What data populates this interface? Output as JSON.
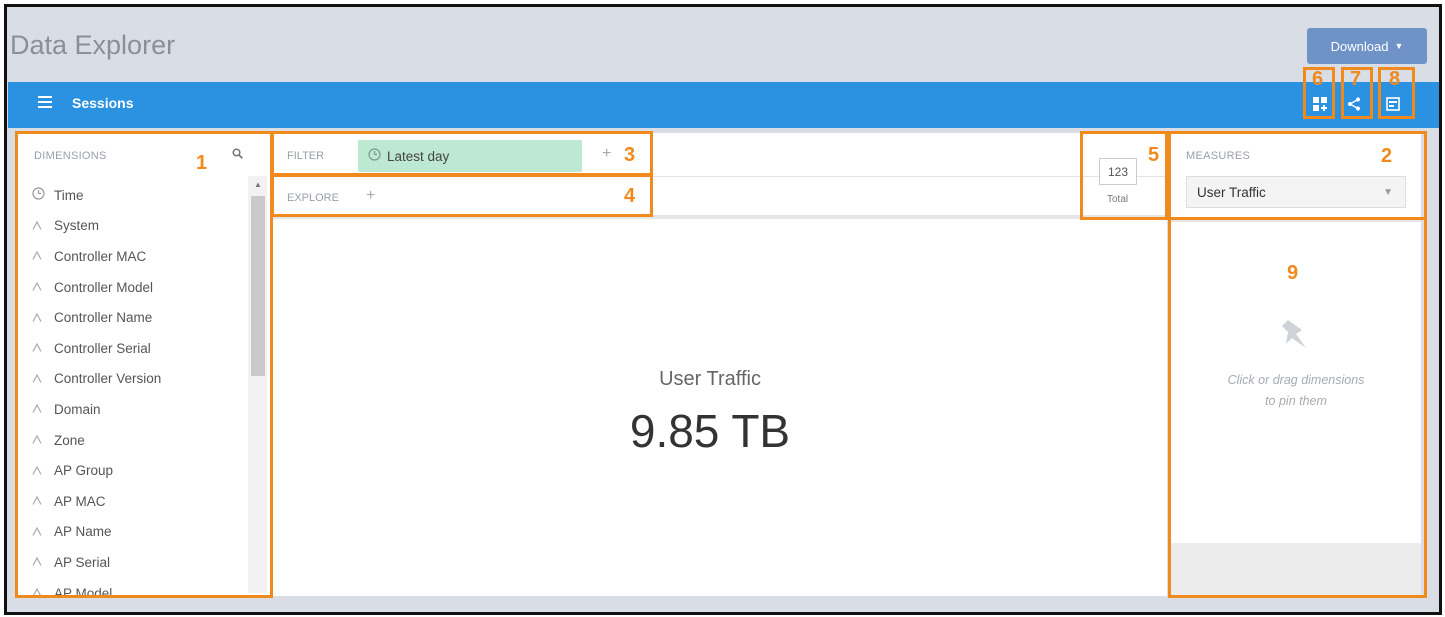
{
  "app": {
    "title": "Data Explorer",
    "download_label": "Download"
  },
  "topbar": {
    "title": "Sessions"
  },
  "dimensions": {
    "header": "DIMENSIONS",
    "items": [
      {
        "label": "Time",
        "icon": "clock-icon"
      },
      {
        "label": "System",
        "icon": "string-icon"
      },
      {
        "label": "Controller MAC",
        "icon": "string-icon"
      },
      {
        "label": "Controller Model",
        "icon": "string-icon"
      },
      {
        "label": "Controller Name",
        "icon": "string-icon"
      },
      {
        "label": "Controller Serial",
        "icon": "string-icon"
      },
      {
        "label": "Controller Version",
        "icon": "string-icon"
      },
      {
        "label": "Domain",
        "icon": "string-icon"
      },
      {
        "label": "Zone",
        "icon": "string-icon"
      },
      {
        "label": "AP Group",
        "icon": "string-icon"
      },
      {
        "label": "AP MAC",
        "icon": "string-icon"
      },
      {
        "label": "AP Name",
        "icon": "string-icon"
      },
      {
        "label": "AP Serial",
        "icon": "string-icon"
      },
      {
        "label": "AP Model",
        "icon": "string-icon"
      }
    ]
  },
  "filter": {
    "label": "FILTER",
    "chip": "Latest day",
    "add": "+"
  },
  "explore": {
    "label": "EXPLORE",
    "add": "+"
  },
  "visualization": {
    "total_icon": "123",
    "total_label": "Total"
  },
  "measures": {
    "header": "MEASURES",
    "selected": "User Traffic"
  },
  "main": {
    "metric_label": "User Traffic",
    "metric_value": "9.85 TB"
  },
  "pinboard": {
    "hint_line1": "Click or drag dimensions",
    "hint_line2": "to pin them"
  },
  "annotations": [
    "1",
    "2",
    "3",
    "4",
    "5",
    "6",
    "7",
    "8",
    "9"
  ],
  "colors": {
    "accent": "#2b91e1",
    "annotation": "#f08a1c",
    "download": "#6f92c7",
    "chip": "#bde8d2"
  }
}
